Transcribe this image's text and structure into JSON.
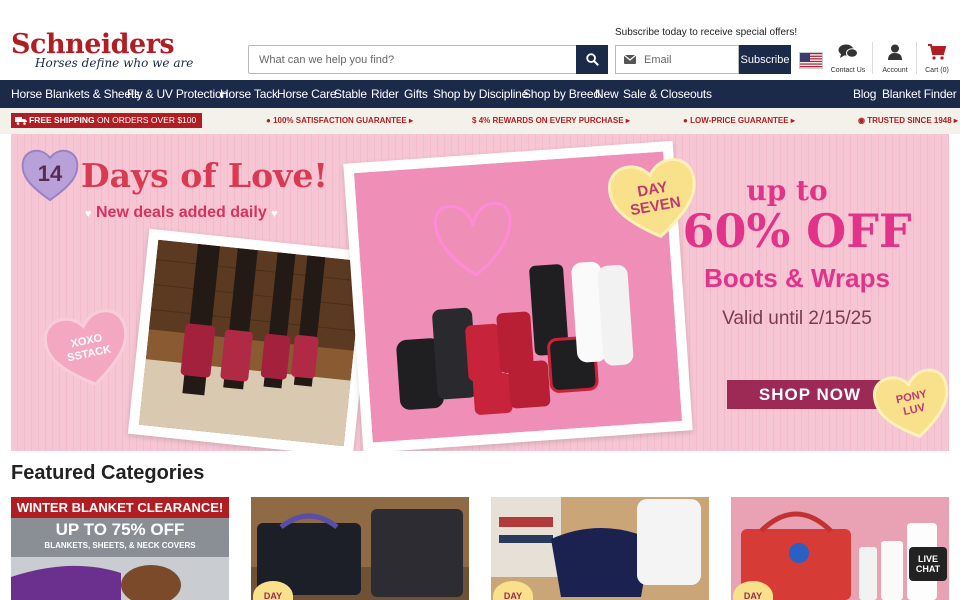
{
  "brand": {
    "name": "Schneiders",
    "tagline": "Horses define who we are"
  },
  "search": {
    "placeholder": "What can we help you find?"
  },
  "newsletter": {
    "label": "Subscribe today to receive special offers!",
    "email_placeholder": "Email",
    "button": "Subscribe"
  },
  "header_icons": {
    "contact": "Contact Us",
    "account": "Account",
    "cart": "Cart (0)"
  },
  "nav": {
    "items": [
      "Horse Blankets & Sheets",
      "Fly & UV Protection",
      "Horse Tack",
      "Horse Care",
      "Stable",
      "Rider",
      "Gifts",
      "Shop by Discipline",
      "Shop by Breed",
      "New",
      "Sale & Closeouts"
    ],
    "right": [
      "Blog",
      "Blanket Finder"
    ]
  },
  "promo": {
    "free_shipping": "FREE SHIPPING",
    "free_shipping_suffix": "ON ORDERS OVER $100",
    "items": [
      "100% SATISFACTION GUARANTEE",
      "4% REWARDS ON EVERY PURCHASE",
      "LOW-PRICE GUARANTEE",
      "TRUSTED SINCE 1948"
    ]
  },
  "hero": {
    "badge_number": "14",
    "title": "Days of Love!",
    "subtitle": "New deals added daily",
    "heart_left": [
      "XOXO",
      "SSTACK"
    ],
    "heart_day": [
      "DAY",
      "SEVEN"
    ],
    "heart_pony": [
      "PONY",
      "LUV"
    ],
    "offer_line1": "up to",
    "offer_line2": "60% OFF",
    "offer_line3": "Boots & Wraps",
    "valid": "Valid until 2/15/25",
    "cta": "SHOP NOW"
  },
  "featured": {
    "title": "Featured Categories",
    "card1": {
      "banner": "WINTER BLANKET CLEARANCE!",
      "headline": "UP TO 75% OFF",
      "sub": "BLANKETS, SHEETS, & NECK COVERS"
    },
    "day_label": "DAY"
  },
  "live_chat": {
    "line1": "LIVE",
    "line2": "CHAT"
  },
  "colors": {
    "navy": "#1b2a48",
    "brand_red": "#b01e23",
    "hero_pink": "#f6c6d4",
    "offer_magenta": "#e2338a"
  }
}
